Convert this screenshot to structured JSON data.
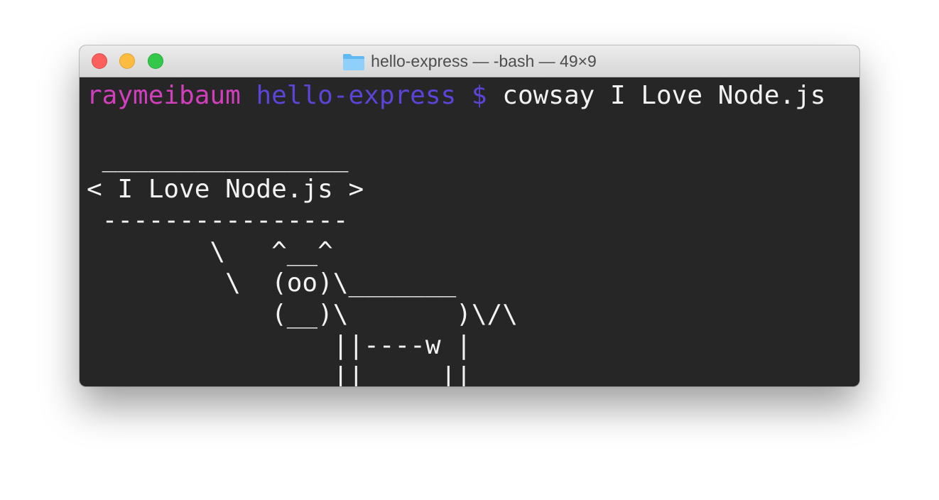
{
  "window": {
    "title": "hello-express — -bash — 49×9",
    "title_icon": "folder-icon",
    "traffic_lights": [
      "close",
      "minimize",
      "zoom"
    ]
  },
  "terminal": {
    "prompt": {
      "user": "raymeibaum",
      "directory": "hello-express",
      "symbol": "$",
      "command": "cowsay I Love Node.js"
    },
    "output": [
      "",
      " ________________",
      "< I Love Node.js >",
      " ----------------",
      "        \\   ^__^",
      "         \\  (oo)\\_______",
      "            (__)\\       )\\/\\",
      "                ||----w |",
      "                ||     ||"
    ]
  },
  "colors": {
    "user": "#d13fbd",
    "directory": "#5b45d9",
    "terminal_background": "#262626",
    "terminal_text": "#f2f2f2"
  }
}
